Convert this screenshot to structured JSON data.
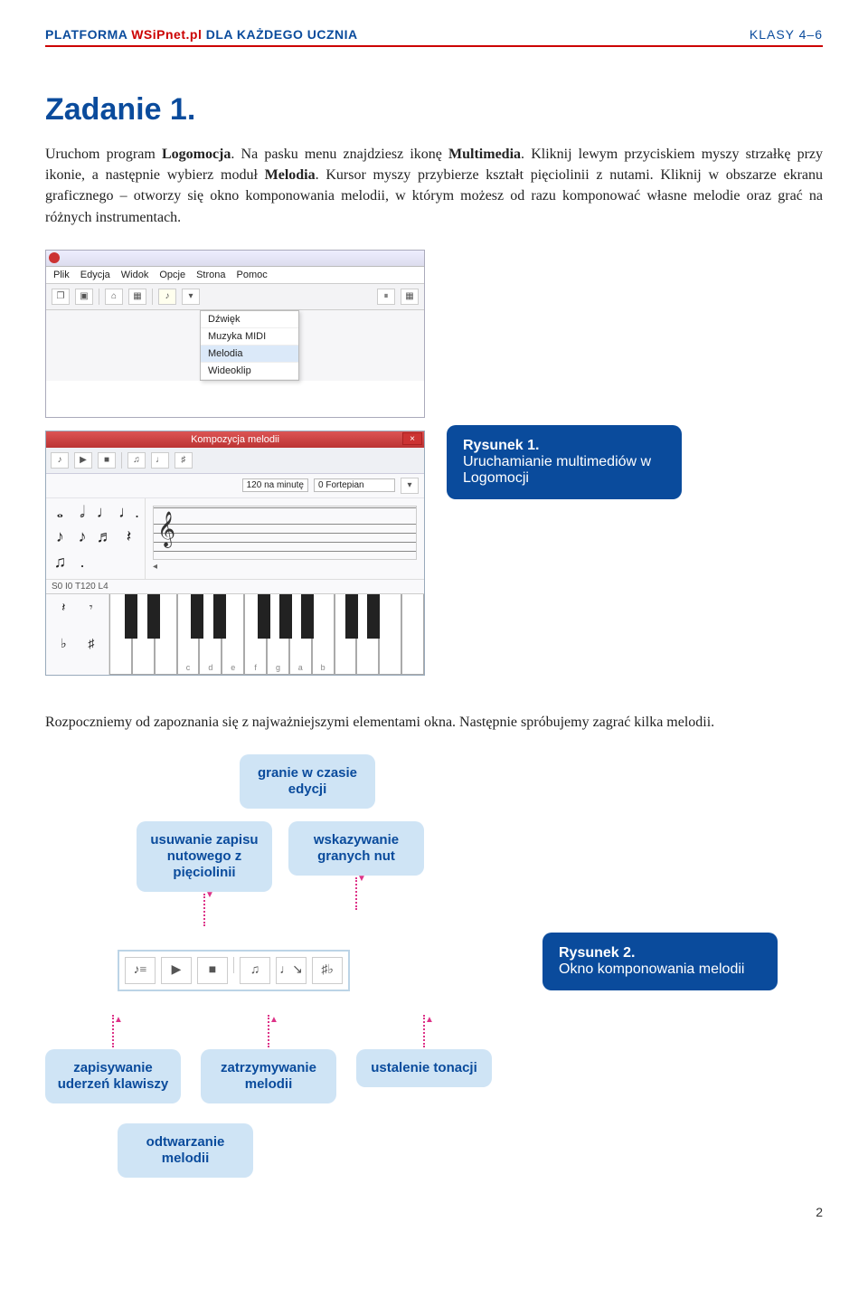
{
  "header": {
    "left_platforma": "PLATFORMA ",
    "left_brand": "WSiPnet.pl",
    "left_rest": " DLA KAŻDEGO UCZNIA",
    "right": "KLASY 4–6"
  },
  "title": "Zadanie 1.",
  "paragraph1_a": "Uruchom program ",
  "paragraph1_b": "Logomocja",
  "paragraph1_c": ". Na pasku menu znajdziesz ikonę ",
  "paragraph1_d": "Multimedia",
  "paragraph1_e": ". Kliknij lewym przyciskiem myszy strzałkę przy ikonie, a następnie wybierz moduł ",
  "paragraph1_f": "Melodia",
  "paragraph1_g": ". Kursor myszy przybierze kształt pięciolinii z nutami. Kliknij w obszarze ekranu graficznego – otworzy się okno komponowania melodii, w którym możesz od razu komponować własne melodie oraz grać na różnych instrumentach.",
  "menus": [
    "Plik",
    "Edycja",
    "Widok",
    "Opcje",
    "Strona",
    "Pomoc"
  ],
  "dropdown_items": [
    "Dźwięk",
    "Muzyka MIDI",
    "Melodia",
    "Wideoklip"
  ],
  "komp_title": "Kompozycja melodii",
  "tempo": "120 na minutę",
  "instrument": "0 Fortepian",
  "status": "S0 I0 T120 L4",
  "white_note_labels": [
    "c",
    "d",
    "e",
    "f",
    "g",
    "a",
    "b"
  ],
  "caption1_title": "Rysunek 1.",
  "caption1_text": "Uruchamianie multimediów w Logomocji",
  "paragraph2": "Rozpoczniemy od zapoznania się z najważniejszymi elementami okna. Następnie spróbujemy zagrać kilka melodii.",
  "label_top_center": "granie w czasie edycji",
  "label_top_left": "usuwanie zapisu nutowego z pięciolinii",
  "label_top_right": "wskazywanie granych nut",
  "label_bottom_1": "zapisywanie uderzeń klawiszy",
  "label_bottom_2": "zatrzymywanie melodii",
  "label_bottom_3": "ustalenie tonacji",
  "label_bottom_4": "odtwarzanie melodii",
  "caption2_title": "Rysunek 2.",
  "caption2_text": "Okno komponowania melodii",
  "page_number": "2"
}
